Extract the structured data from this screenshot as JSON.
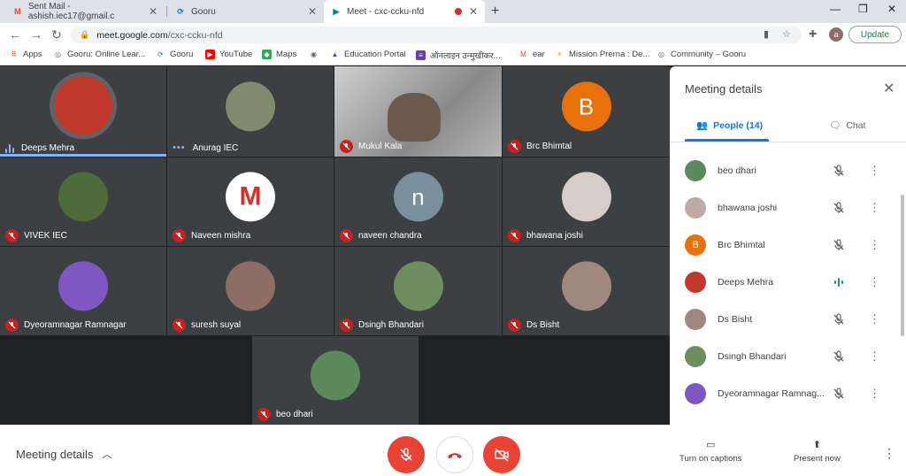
{
  "tabs": [
    {
      "title": "Sent Mail - ashish.iec17@gmail.c",
      "icon": "gmail-icon"
    },
    {
      "title": "Gooru",
      "icon": "gooru-icon"
    },
    {
      "title": "Meet - cxc-ccku-nfd",
      "icon": "meet-icon"
    }
  ],
  "address": {
    "host": "meet.google.com",
    "path": "/cxc-ccku-nfd"
  },
  "profile_initial": "a",
  "update_label": "Update",
  "bookmarks": [
    "Apps",
    "Gooru: Online Lear...",
    "Gooru",
    "YouTube",
    "Maps",
    "Education Portal",
    "ऑनलाइन उन्मुखीकर...",
    "ear",
    "Mission Prerna : De...",
    "Community – Gooru"
  ],
  "tiles": [
    {
      "name": "Deeps Mehra",
      "status": "speaking",
      "color": "#c0392b"
    },
    {
      "name": "Anurag IEC",
      "status": "connecting",
      "color": "#7f8c6d"
    },
    {
      "name": "Mukul Kala",
      "status": "muted",
      "color": "#9e9e9e"
    },
    {
      "name": "Brc Bhimtal",
      "status": "muted",
      "initial": "B",
      "color": "#e8710a"
    },
    {
      "name": "VIVEK IEC",
      "status": "muted",
      "color": "#4e6b3a"
    },
    {
      "name": "Naveen mishra",
      "status": "muted",
      "initial": "M",
      "color": "#ffffff"
    },
    {
      "name": "naveen chandra",
      "status": "muted",
      "initial": "n",
      "color": "#78909c"
    },
    {
      "name": "bhawana joshi",
      "status": "muted",
      "color": "#d7ccc8"
    },
    {
      "name": "Dyeoramnagar Ramnagar",
      "status": "muted",
      "color": "#7e57c2"
    },
    {
      "name": "suresh suyal",
      "status": "muted",
      "color": "#8d6e63"
    },
    {
      "name": "Dsingh Bhandari",
      "status": "muted",
      "color": "#6d8f5f"
    },
    {
      "name": "Ds Bisht",
      "status": "muted",
      "color": "#a1887f"
    },
    {
      "name": "beo dhari",
      "status": "muted",
      "color": "#5d8a5b"
    }
  ],
  "panel": {
    "title": "Meeting details",
    "people_tab": "People (14)",
    "chat_tab": "Chat",
    "people": [
      {
        "name": "beo dhari",
        "status": "muted",
        "color": "#5d8a5b"
      },
      {
        "name": "bhawana joshi",
        "status": "muted",
        "color": "#bcaaa4"
      },
      {
        "name": "Brc Bhimtal",
        "status": "muted",
        "initial": "B",
        "color": "#e8710a"
      },
      {
        "name": "Deeps Mehra",
        "status": "speaking",
        "color": "#c0392b"
      },
      {
        "name": "Ds Bisht",
        "status": "muted",
        "color": "#a1887f"
      },
      {
        "name": "Dsingh Bhandari",
        "status": "muted",
        "color": "#6d8f5f"
      },
      {
        "name": "Dyeoramnagar Ramnag...",
        "status": "muted",
        "color": "#7e57c2"
      }
    ]
  },
  "bottom": {
    "meeting_details": "Meeting details",
    "captions": "Turn on captions",
    "present": "Present now"
  }
}
